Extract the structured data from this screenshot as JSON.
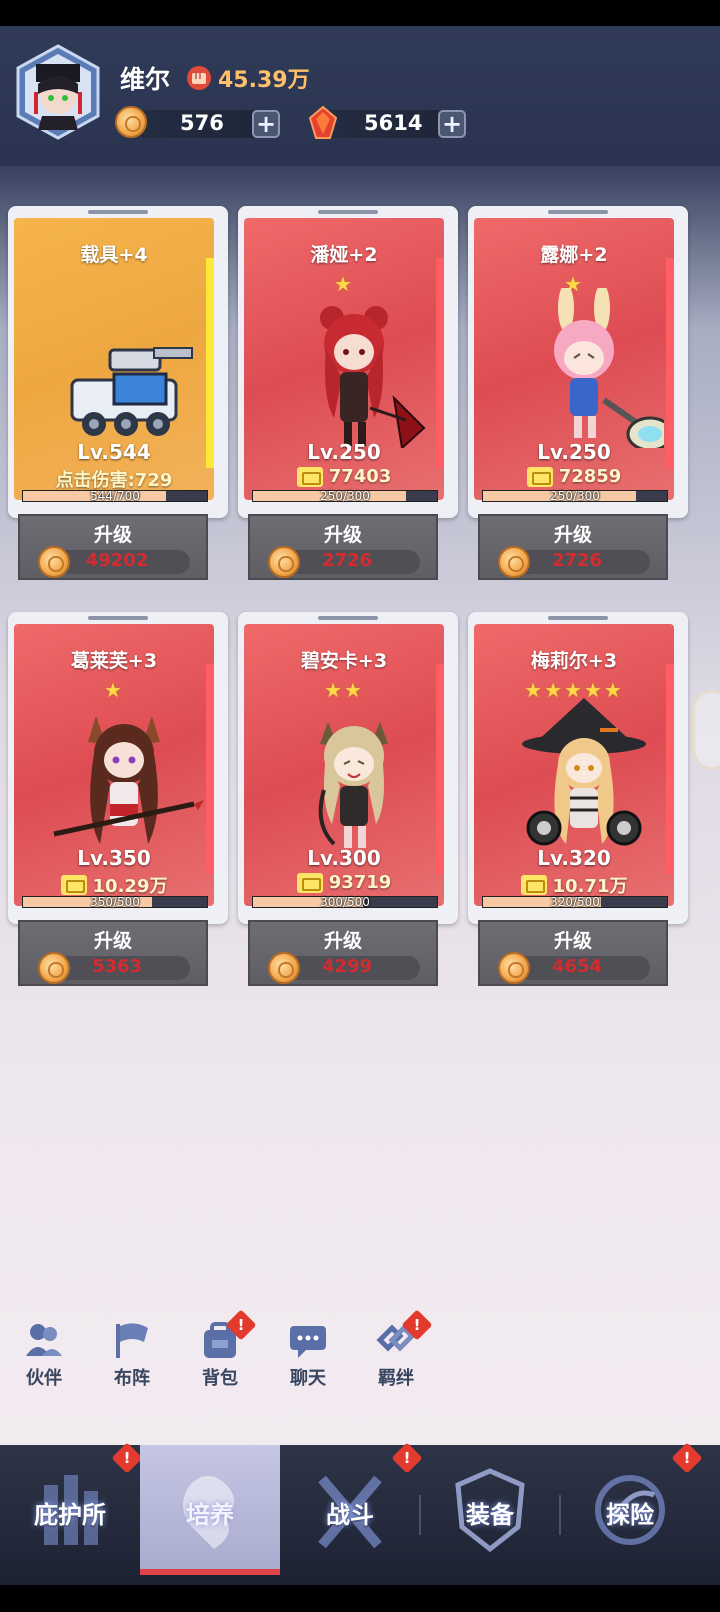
{
  "player": {
    "name": "维尔",
    "power": "45.39万"
  },
  "resources": [
    {
      "icon": "bread-coin-icon",
      "value": "576"
    },
    {
      "icon": "red-crystal-icon",
      "value": "5614"
    }
  ],
  "cards": [
    {
      "name": "载具+4",
      "stars": "",
      "level": "Lv.544",
      "stat": "点击伤害:729",
      "stat_icon": false,
      "xp": "544/700",
      "xp_frac": 0.777,
      "theme": "gold",
      "upgrade_label": "升级",
      "cost": "49202"
    },
    {
      "name": "潘娅+2",
      "stars": "★",
      "level": "Lv.250",
      "stat": "77403",
      "stat_icon": true,
      "xp": "250/300",
      "xp_frac": 0.833,
      "theme": "red",
      "upgrade_label": "升级",
      "cost": "2726"
    },
    {
      "name": "露娜+2",
      "stars": "★",
      "level": "Lv.250",
      "stat": "72859",
      "stat_icon": true,
      "xp": "250/300",
      "xp_frac": 0.833,
      "theme": "red",
      "upgrade_label": "升级",
      "cost": "2726"
    },
    {
      "name": "葛莱芙+3",
      "stars": "★",
      "level": "Lv.350",
      "stat": "10.29万",
      "stat_icon": true,
      "xp": "350/500",
      "xp_frac": 0.7,
      "theme": "red",
      "upgrade_label": "升级",
      "cost": "5363"
    },
    {
      "name": "碧安卡+3",
      "stars": "★★",
      "level": "Lv.300",
      "stat": "93719",
      "stat_icon": true,
      "xp": "300/500",
      "xp_frac": 0.6,
      "theme": "red",
      "upgrade_label": "升级",
      "cost": "4299"
    },
    {
      "name": "梅莉尔+3",
      "stars": "★★★★★",
      "level": "Lv.320",
      "stat": "10.71万",
      "stat_icon": true,
      "xp": "320/500",
      "xp_frac": 0.64,
      "theme": "red",
      "upgrade_label": "升级",
      "cost": "4654"
    }
  ],
  "quick_nav": [
    {
      "label": "伙伴",
      "icon": "partner-icon",
      "alert": false
    },
    {
      "label": "布阵",
      "icon": "flag-icon",
      "alert": false
    },
    {
      "label": "背包",
      "icon": "backpack-icon",
      "alert": true
    },
    {
      "label": "聊天",
      "icon": "chat-icon",
      "alert": false
    },
    {
      "label": "羁绊",
      "icon": "bond-icon",
      "alert": true
    }
  ],
  "bottom_nav": [
    {
      "label": "庇护所",
      "icon": "shelter-icon",
      "alert": true,
      "active": false
    },
    {
      "label": "培养",
      "icon": "train-icon",
      "alert": false,
      "active": true
    },
    {
      "label": "战斗",
      "icon": "crossed-swords-icon",
      "alert": true,
      "active": false
    },
    {
      "label": "装备",
      "icon": "shield-icon",
      "alert": false,
      "active": false
    },
    {
      "label": "探险",
      "icon": "explore-icon",
      "alert": true,
      "active": false
    }
  ],
  "alert_mark": "!"
}
